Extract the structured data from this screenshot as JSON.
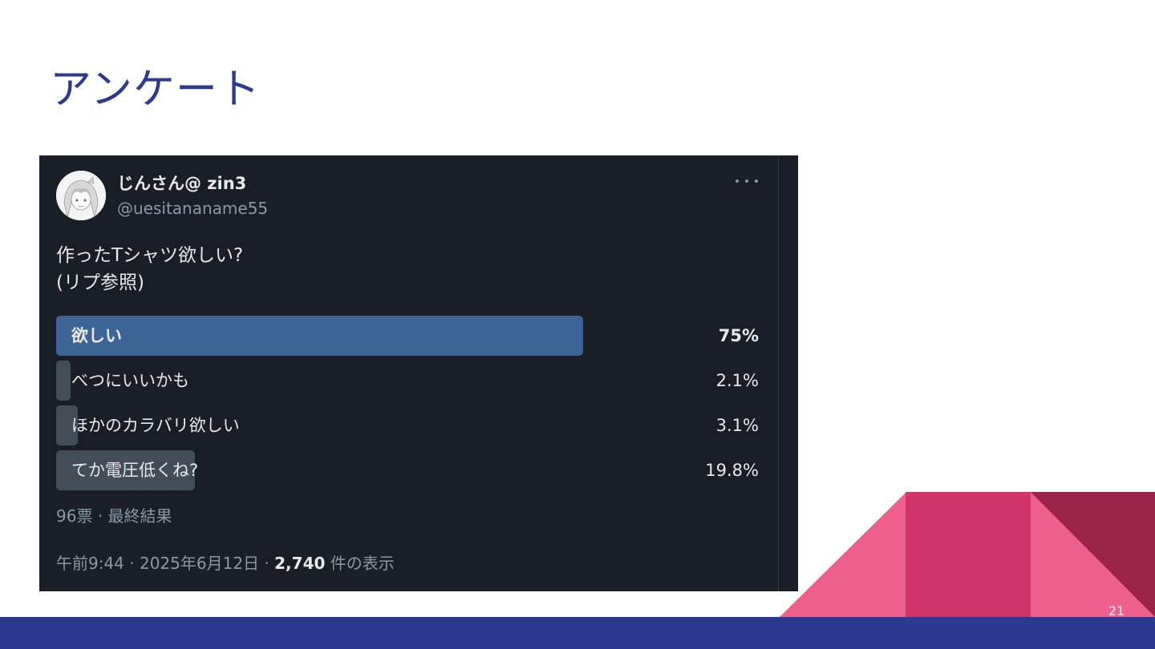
{
  "slide": {
    "title": "アンケート",
    "page_number": "21"
  },
  "tweet": {
    "display_name": "じんさん@ zin3",
    "handle": "@uesitananame55",
    "text_lines": [
      "作ったTシャツ欲しい?",
      "(リプ参照)"
    ],
    "poll": {
      "options": [
        {
          "label": "欲しい",
          "percent_text": "75%",
          "percent": 75,
          "winner": true
        },
        {
          "label": "べつにいいかも",
          "percent_text": "2.1%",
          "percent": 2.1,
          "winner": false
        },
        {
          "label": "ほかのカラバリ欲しい",
          "percent_text": "3.1%",
          "percent": 3.1,
          "winner": false
        },
        {
          "label": "てか電圧低くね?",
          "percent_text": "19.8%",
          "percent": 19.8,
          "winner": false
        }
      ],
      "summary": "96票 · 最終結果"
    },
    "meta": {
      "time_date": "午前9:44 · 2025年6月12日 · ",
      "views_count": "2,740",
      "views_label": " 件の表示"
    }
  },
  "colors": {
    "title": "#2b3990",
    "band": "#2b3990",
    "deco_pink_light": "#ef5f8e",
    "deco_pink_mid": "#d0346a",
    "deco_pink_dark": "#9b2249",
    "tweet_bg": "#1a1f27",
    "winner_bar": "#3c6596",
    "loser_bar": "#434d58"
  },
  "icons": {
    "more": "ellipsis-icon",
    "avatar": "anime-avatar"
  }
}
